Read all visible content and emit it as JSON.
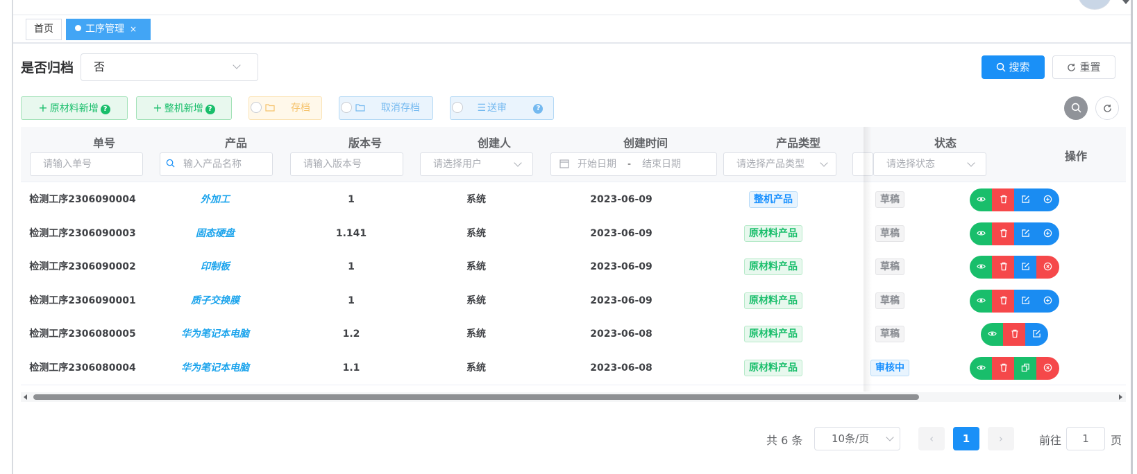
{
  "tabs": {
    "home": "首页",
    "active": "工序管理",
    "close": "×"
  },
  "filter": {
    "archived_label": "是否归档",
    "archived_value": "否"
  },
  "actions": {
    "search": "搜索",
    "reset": "重置"
  },
  "toolbar": {
    "add_raw": "原材料新增",
    "add_whole": "整机新增",
    "archive": "存档",
    "unarchive": "取消存档",
    "submit_review": "送审",
    "help_mark": "?"
  },
  "table": {
    "headers": [
      "单号",
      "产品",
      "版本号",
      "创建人",
      "创建时间",
      "产品类型",
      "状态",
      "操作"
    ],
    "filters": {
      "order_no": "请输入单号",
      "product": "输入产品名称",
      "version": "请输入版本号",
      "creator": "请选择用户",
      "date_start": "开始日期",
      "date_sep": "-",
      "date_end": "结束日期",
      "product_type": "请选择产品类型",
      "status": "请选择状态"
    },
    "rows": [
      {
        "order_no": "检测工序2306090004",
        "product": "外加工",
        "version": "1",
        "creator": "系统",
        "created": "2023-06-09",
        "type": "整机产品",
        "status": "草稿",
        "ops": [
          "view",
          "delete",
          "edit",
          "add"
        ]
      },
      {
        "order_no": "检测工序2306090003",
        "product": "固态硬盘",
        "version": "1.141",
        "creator": "系统",
        "created": "2023-06-09",
        "type": "原材料产品",
        "status": "草稿",
        "ops": [
          "view",
          "delete",
          "edit",
          "add"
        ]
      },
      {
        "order_no": "检测工序2306090002",
        "product": "印制板",
        "version": "1",
        "creator": "系统",
        "created": "2023-06-09",
        "type": "原材料产品",
        "status": "草稿",
        "ops": [
          "view",
          "delete",
          "edit",
          "cancel"
        ]
      },
      {
        "order_no": "检测工序2306090001",
        "product": "质子交换膜",
        "version": "1",
        "creator": "系统",
        "created": "2023-06-09",
        "type": "原材料产品",
        "status": "草稿",
        "ops": [
          "view",
          "delete",
          "edit",
          "add"
        ]
      },
      {
        "order_no": "检测工序2306080005",
        "product": "华为笔记本电脑",
        "version": "1.2",
        "creator": "系统",
        "created": "2023-06-08",
        "type": "原材料产品",
        "status": "草稿",
        "ops": [
          "view",
          "delete",
          "edit"
        ]
      },
      {
        "order_no": "检测工序2306080004",
        "product": "华为笔记本电脑",
        "version": "1.1",
        "creator": "系统",
        "created": "2023-06-08",
        "type": "原材料产品",
        "status": "审核中",
        "ops": [
          "view",
          "delete",
          "copy",
          "cancel"
        ]
      }
    ]
  },
  "pagination": {
    "total": "共 6 条",
    "page_size": "10条/页",
    "current_page": "1",
    "goto_label": "前往",
    "goto_value": "1",
    "page_unit": "页"
  },
  "colors": {
    "primary": "#1a90f7",
    "success": "#19be6b",
    "danger": "#f5484a",
    "link": "#1aa3ec"
  }
}
